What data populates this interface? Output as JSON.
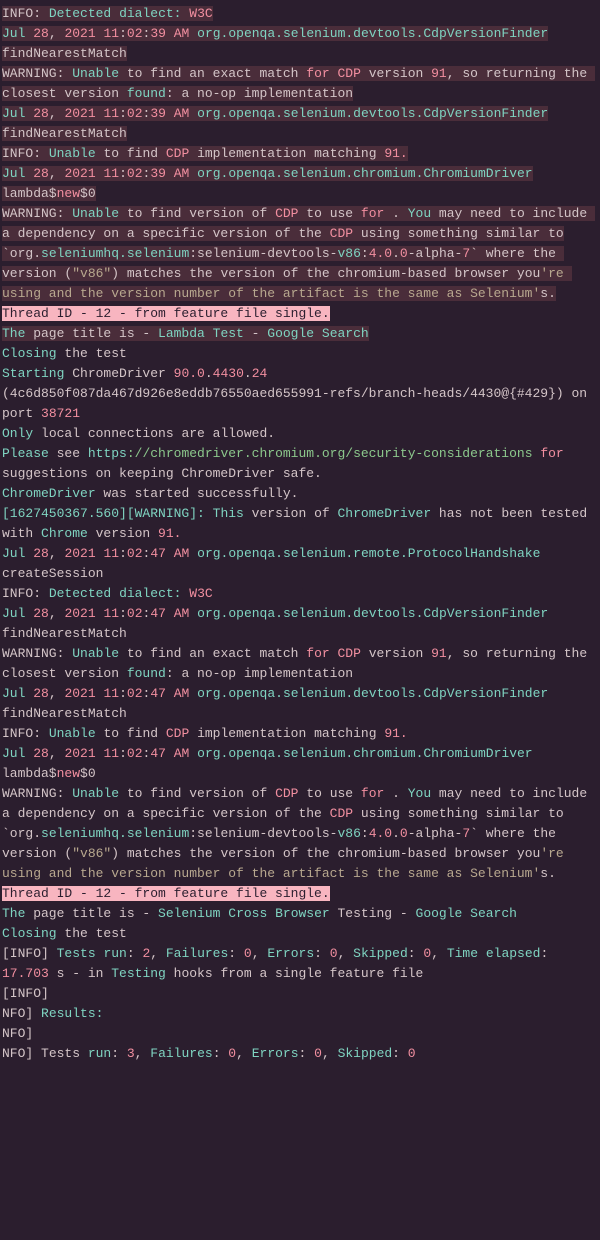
{
  "l0": "INFO:",
  "l0a": "Detected",
  "l0b": "dialect:",
  "l0c": "W3C",
  "l1a": "Jul ",
  "l1b": "28",
  "l1c": ", ",
  "l1d": "2021",
  "l1e": " ",
  "l1f": "11",
  "l1g": ":",
  "l1h": "02",
  "l1i": ":",
  "l1j": "39",
  "l1k": " AM ",
  "l1l": "org.openqa.selenium.devtools.CdpVersionFinder",
  "l2": "findNearestMatch",
  "l3a": "WARNING:",
  "l3b": "Unable",
  "l3c": " to find an exact match ",
  "l3d": "for",
  "l3e": "CDP",
  "l3f": " version ",
  "l3g": "91",
  "l3h": ", so returning the closest version ",
  "l3i": "found",
  "l3j": ": a no-op implementation",
  "l6a": "INFO:",
  "l6b": "Unable",
  "l6c": " to find ",
  "l6d": "CDP",
  "l6e": " implementation matching ",
  "l6f": "91.",
  "l7": "org.openqa.selenium.chromium.ChromiumDriver",
  "l8a": "lambda$",
  "l8b": "new",
  "l8c": "$0",
  "l9a": "WARNING:",
  "l9b": "Unable",
  "l9c": " to find version of ",
  "l9d": "CDP",
  "l9e": " to use ",
  "l9f": "for",
  "l9g": " . ",
  "l9h": "You",
  "l9i": " may need to include a dependency on a specific version of the ",
  "l9j": "CDP",
  "l9k": " using something similar to",
  "l10a": "`org.",
  "l10b": "seleniumhq.selenium",
  "l10c": ":selenium-devtools-",
  "l10d": "v86",
  "l10e": ":",
  "l10f": "4.0",
  "l10g": ".",
  "l10h": "0",
  "l10i": "-alpha-",
  "l10j": "7",
  "l10k": "` where the version (",
  "l10l": "\"v86\"",
  "l10m": ") matches the version of the chromium-based browser you",
  "l10n": "'re using and the version number of the artifact is the same as Selenium'",
  "l10o": "s.",
  "thread": "Thread ID - 12 - from feature file single.",
  "pt1a": "The",
  "pt1b": " page title is - ",
  "pt1c": "Lambda",
  "pt1d": "Test",
  "pt1e": " - ",
  "pt1f": "Google",
  "pt1g": "Search",
  "cl1": "Closing",
  "cl2": " the test",
  "s1": "Starting",
  "s2": " ChromeDriver ",
  "s3": "90.0",
  "s4": ".",
  "s5": "4430",
  "s6": ".",
  "s7": "24",
  "hash": " (4c6d850f087da467d926e8eddb76550aed655991-refs/branch-heads/4430@{#429}) on port ",
  "port": "38721",
  "only1": "Only",
  "only2": " local connections are allowed.",
  "pl1": "Please",
  "pl2": " see ",
  "pl3": "https",
  "pl4": "://chromedriver.chromium.org/security-considerations ",
  "pl5": "for",
  "pl6": " suggestions on keeping ChromeDriver safe.",
  "cd1": "ChromeDriver",
  "cd2": " was started successfully.",
  "w1": "[1627450367.560][WARNING]:",
  "w2": "This",
  "w3": " version of ",
  "w4": "ChromeDriver",
  "w5": " has not been tested with ",
  "w6": "Chrome",
  "w7": " version ",
  "w8": "91.",
  "t47": "47",
  "ph": "org.openqa.selenium.remote.ProtocolHandshake",
  "cs": "createSession",
  "pt2c": "Selenium",
  "pt2d": "Cross",
  "pt2e": "Browser",
  "pt2f": " Testing - ",
  "sum1": "[INFO] ",
  "sum2": "Tests",
  "sum3": "run",
  "sum4": ": ",
  "sum5": "2",
  "sum6": ", ",
  "sum7": "Failures",
  "sum8": ": ",
  "sum9": "0",
  "sum10": ", ",
  "sum11": "Errors",
  "sum12": ": ",
  "sum13": "0",
  "sum14": ", ",
  "sum15": "Skipped",
  "sum16": ": ",
  "sum17": "0",
  "sum18": ", ",
  "sum19": "Time",
  "sum20": "elapsed",
  "sum21": ": ",
  "sum22": "17.703",
  "sum23": " s - in ",
  "sum24": "Testing",
  "sum25": " hooks from a single feature file",
  "inf": "[INFO]",
  "nfo": "NFO]",
  "res": " Results:",
  "f1": " Tests ",
  "f2": "run",
  "f3": ": ",
  "f4": "3",
  "f5": ", ",
  "f6": "Failures",
  "f7": ": ",
  "f8": "0",
  "f9": ", ",
  "f10": "Errors",
  "f11": ": ",
  "f12": "0",
  "f13": ", ",
  "f14": "Skipped",
  "f15": ": ",
  "f16": "0"
}
